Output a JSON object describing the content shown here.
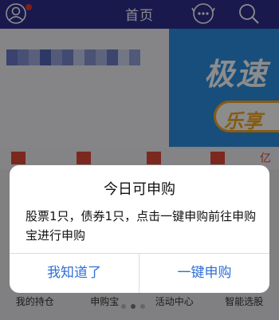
{
  "header": {
    "title": "首页",
    "icons": [
      "user-icon",
      "message-icon",
      "search-icon"
    ]
  },
  "background": {
    "bottom_nav": [
      "我的持仓",
      "申购宝",
      "活动中心",
      "智能选股"
    ],
    "banner_text": "极速",
    "banner_sub": "乐享",
    "side_char": "亿"
  },
  "dialog": {
    "title": "今日可申购",
    "message": "股票1只，债券1只，点击一键申购前往申购宝进行申购",
    "cancel_label": "我知道了",
    "confirm_label": "一键申购"
  },
  "colors": {
    "header": "#2f2f8f",
    "accent": "#2f6fd6",
    "banner": "#2c8fe0",
    "badge": "#e53935"
  }
}
